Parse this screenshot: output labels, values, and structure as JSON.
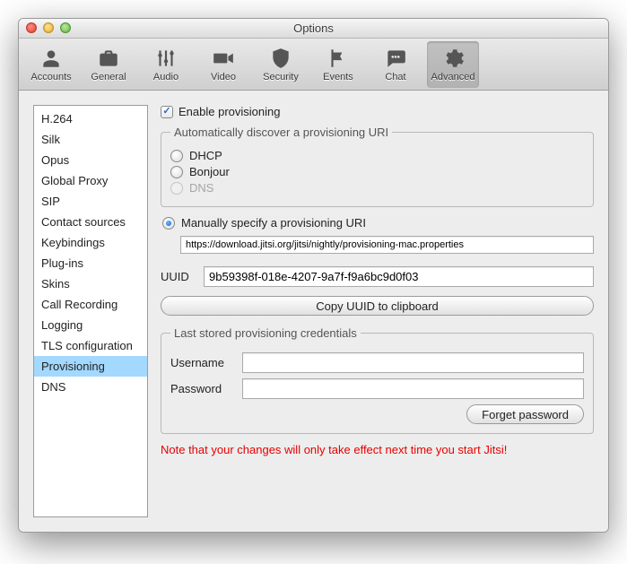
{
  "window": {
    "title": "Options"
  },
  "toolbar": {
    "items": [
      {
        "label": "Accounts"
      },
      {
        "label": "General"
      },
      {
        "label": "Audio"
      },
      {
        "label": "Video"
      },
      {
        "label": "Security"
      },
      {
        "label": "Events"
      },
      {
        "label": "Chat"
      },
      {
        "label": "Advanced"
      }
    ],
    "selected_index": 7
  },
  "sidebar": {
    "items": [
      "H.264",
      "Silk",
      "Opus",
      "Global Proxy",
      "SIP",
      "Contact sources",
      "Keybindings",
      "Plug-ins",
      "Skins",
      "Call Recording",
      "Logging",
      "TLS configuration",
      "Provisioning",
      "DNS"
    ],
    "selected_index": 12
  },
  "main": {
    "enable_label": "Enable provisioning",
    "enable_checked": true,
    "auto_group": {
      "legend": "Automatically discover a provisioning URI",
      "options": [
        {
          "label": "DHCP",
          "state": "unselected"
        },
        {
          "label": "Bonjour",
          "state": "unselected"
        },
        {
          "label": "DNS",
          "state": "disabled"
        }
      ]
    },
    "manual": {
      "label": "Manually specify a provisioning URI",
      "selected": true,
      "value": "https://download.jitsi.org/jitsi/nightly/provisioning-mac.properties"
    },
    "uuid": {
      "label": "UUID",
      "value": "9b59398f-018e-4207-9a7f-f9a6bc9d0f03"
    },
    "copy_button": "Copy UUID to clipboard",
    "credentials": {
      "legend": "Last stored provisioning credentials",
      "username_label": "Username",
      "username_value": "",
      "password_label": "Password",
      "password_value": "",
      "forget_button": "Forget password"
    },
    "note": "Note that your changes will only take effect next time you start Jitsi!"
  }
}
